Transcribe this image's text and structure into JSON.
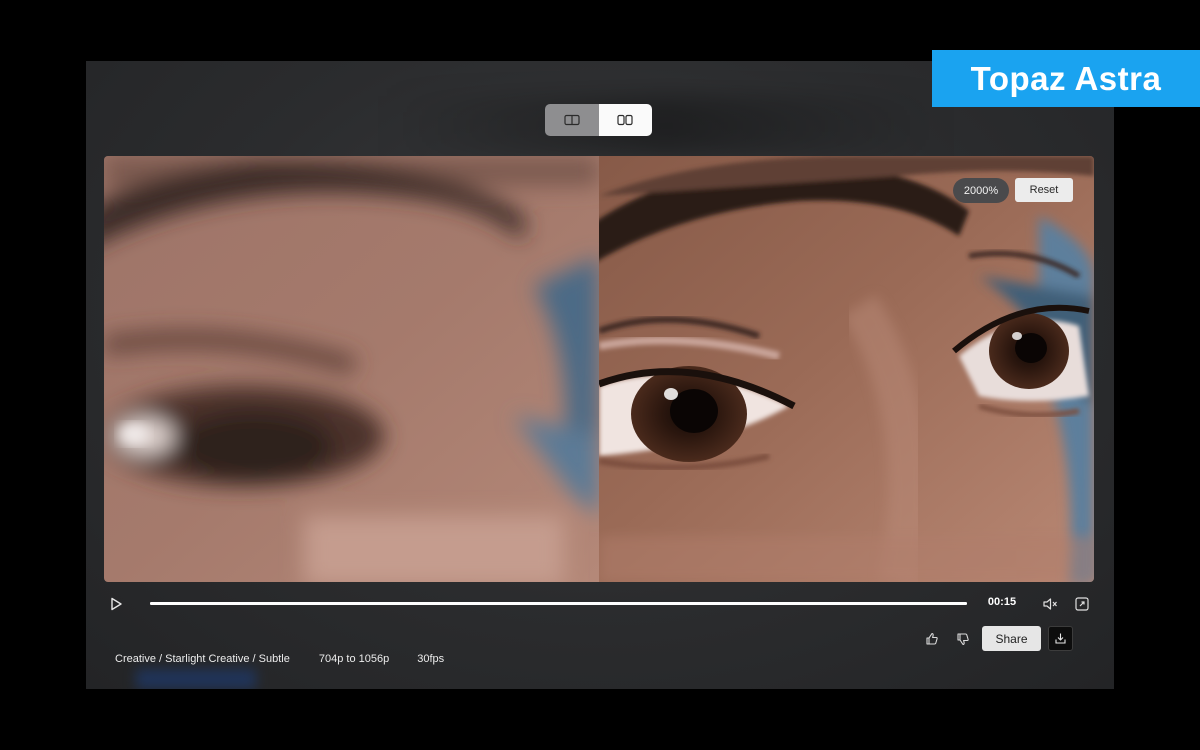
{
  "brand": {
    "label": "Topaz Astra",
    "color": "#1aa3f0"
  },
  "view_toggle": {
    "options": [
      {
        "name": "split-view",
        "icon": "split-view-icon",
        "selected": true
      },
      {
        "name": "side-by-side-view",
        "icon": "side-by-side-icon",
        "selected": false
      }
    ]
  },
  "comparison": {
    "zoom": "2000%",
    "reset_label": "Reset",
    "left_pane": "original",
    "right_pane": "enhanced"
  },
  "player": {
    "play_icon": "play-icon",
    "progress": 1.0,
    "time": "00:15",
    "mute_icon": "mute-icon",
    "fullscreen_icon": "fullscreen-icon"
  },
  "actions": {
    "thumbs_up_icon": "thumbs-up-icon",
    "thumbs_down_icon": "thumbs-down-icon",
    "share_label": "Share",
    "download_icon": "download-icon"
  },
  "meta": {
    "model": "Creative / Starlight Creative / Subtle",
    "resolution": "704p to 1056p",
    "fps": "30fps"
  }
}
